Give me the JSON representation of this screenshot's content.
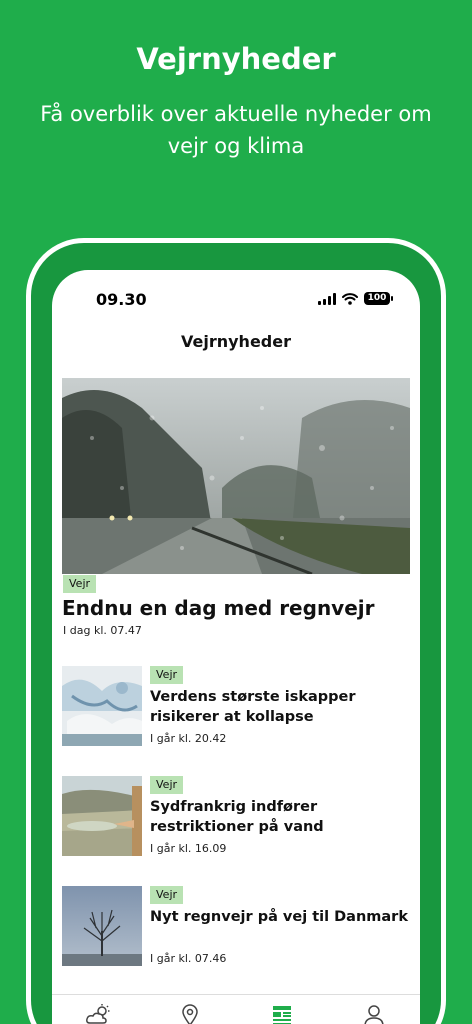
{
  "promo": {
    "title": "Vejrnyheder",
    "subtitle": "Få overblik over aktuelle nyheder om vejr og klima"
  },
  "status_bar": {
    "time": "09.30",
    "battery": "100"
  },
  "nav": {
    "title": "Vejrnyheder"
  },
  "hero": {
    "tag": "Vejr",
    "title": "Endnu en dag med regnvejr",
    "time": "I dag kl. 07.47",
    "image": "rainy-road-photo"
  },
  "articles": [
    {
      "tag": "Vejr",
      "title": "Verdens største iskapper risikerer at kollapse",
      "time": "I går kl. 20.42",
      "image": "ice-sheet-photo"
    },
    {
      "tag": "Vejr",
      "title": "Sydfrankrig indfører restriktioner på vand",
      "time": "I går kl. 16.09",
      "image": "dry-lake-photo"
    },
    {
      "tag": "Vejr",
      "title": "Nyt regnvejr på vej til Danmark",
      "time": "I går kl. 07.46",
      "image": "foggy-tree-photo"
    }
  ],
  "tabbar": {
    "items": [
      {
        "icon": "cloud-sun-icon",
        "active": false
      },
      {
        "icon": "location-pin-icon",
        "active": false
      },
      {
        "icon": "news-icon",
        "active": true
      },
      {
        "icon": "profile-icon",
        "active": false
      }
    ]
  },
  "colors": {
    "brand_green": "#1fad4b",
    "tag_bg": "#b9e2b3",
    "active_tab": "#1fad4b"
  }
}
